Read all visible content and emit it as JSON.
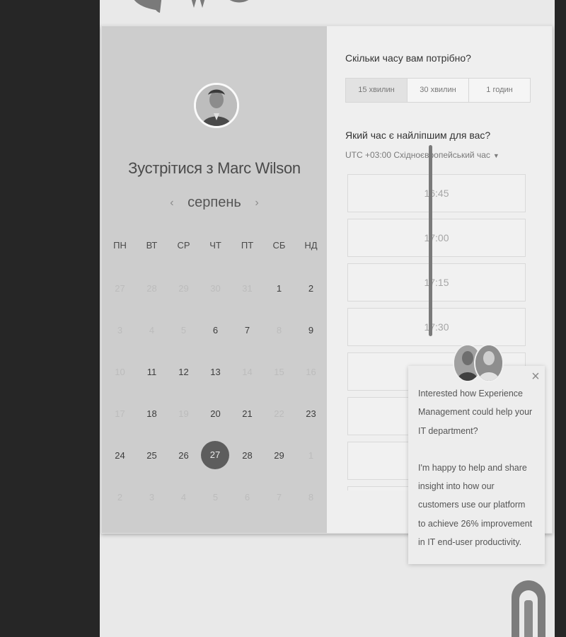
{
  "calendar": {
    "meet_title": "Зустрітися з Marc Wilson",
    "month": "серпень",
    "weekdays": [
      "ПН",
      "ВТ",
      "СР",
      "ЧТ",
      "ПТ",
      "СБ",
      "НД"
    ],
    "weeks": [
      [
        "27",
        "28",
        "29",
        "30",
        "31",
        "1",
        "2"
      ],
      [
        "3",
        "4",
        "5",
        "6",
        "7",
        "8",
        "9"
      ],
      [
        "10",
        "11",
        "12",
        "13",
        "14",
        "15",
        "16"
      ],
      [
        "17",
        "18",
        "19",
        "20",
        "21",
        "22",
        "23"
      ],
      [
        "24",
        "25",
        "26",
        "27",
        "28",
        "29",
        "1"
      ],
      [
        "2",
        "3",
        "4",
        "5",
        "6",
        "7",
        "8"
      ]
    ],
    "selected_day": "27"
  },
  "booking": {
    "duration_question": "Скільки часу вам потрібно?",
    "durations": [
      "15 хвилин",
      "30 хвилин",
      "1 годин"
    ],
    "selected_duration": "15 хвилин",
    "time_question": "Який час є найліпшим для вас?",
    "timezone": "UTC +03:00 Східноєвропейський час",
    "slots": [
      "16:45",
      "17:00",
      "17:15",
      "17:30",
      "",
      "",
      ""
    ]
  },
  "chat": {
    "paragraph1": "Interested how Experience Management could help your IT department?",
    "paragraph2": "I'm happy to help and share insight into how our customers use our platform to achieve 26% improvement in IT end-user productivity.",
    "close_symbol": "×"
  },
  "icons": {
    "prev": "chevron-left-icon",
    "next": "chevron-right-icon",
    "tz_caret": "caret-down-icon",
    "close": "close-icon",
    "launcher": "chat-launcher-icon"
  },
  "colors": {
    "page_bg": "#262626",
    "calendar_panel": "#cdcdcd",
    "selected_day": "#5d5d5d"
  }
}
